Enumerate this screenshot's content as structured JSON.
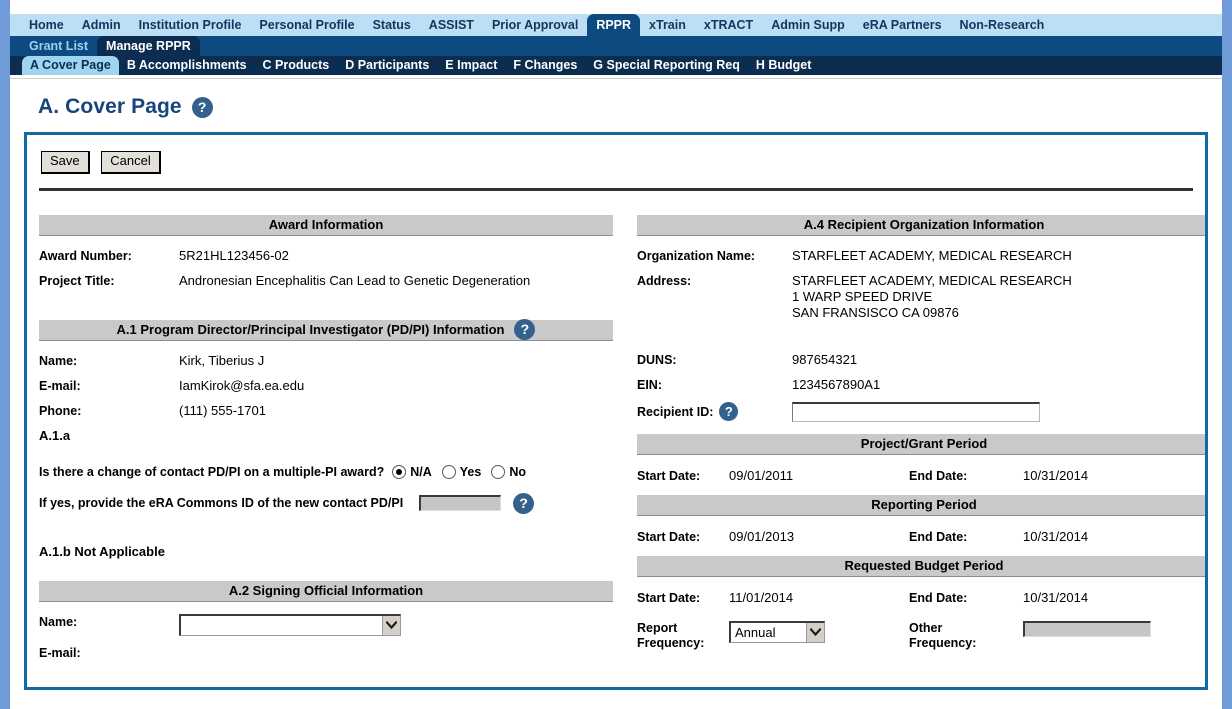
{
  "nav": {
    "main_items": [
      {
        "label": "Home",
        "active": false
      },
      {
        "label": "Admin",
        "active": false
      },
      {
        "label": "Institution Profile",
        "active": false
      },
      {
        "label": "Personal Profile",
        "active": false
      },
      {
        "label": "Status",
        "active": false
      },
      {
        "label": "ASSIST",
        "active": false
      },
      {
        "label": "Prior Approval",
        "active": false
      },
      {
        "label": "RPPR",
        "active": true
      },
      {
        "label": "xTrain",
        "active": false
      },
      {
        "label": "xTRACT",
        "active": false
      },
      {
        "label": "Admin Supp",
        "active": false
      },
      {
        "label": "eRA Partners",
        "active": false
      },
      {
        "label": "Non-Research",
        "active": false
      }
    ],
    "sub_items": [
      {
        "label": "Grant List",
        "active": false
      },
      {
        "label": "Manage RPPR",
        "active": true
      }
    ],
    "tabs": [
      {
        "label": "A Cover Page",
        "active": true
      },
      {
        "label": "B Accomplishments",
        "active": false
      },
      {
        "label": "C Products",
        "active": false
      },
      {
        "label": "D Participants",
        "active": false
      },
      {
        "label": "E Impact",
        "active": false
      },
      {
        "label": "F Changes",
        "active": false
      },
      {
        "label": "G Special Reporting Req",
        "active": false
      },
      {
        "label": "H Budget",
        "active": false
      }
    ]
  },
  "page": {
    "title": "A. Cover Page",
    "help_glyph": "?"
  },
  "toolbar": {
    "save_label": "Save",
    "cancel_label": "Cancel"
  },
  "award_information": {
    "heading": "Award Information",
    "award_number_label": "Award Number:",
    "award_number_value": "5R21HL123456-02",
    "project_title_label": "Project Title:",
    "project_title_value": "Andronesian Encephalitis Can Lead to Genetic Degeneration"
  },
  "pdpi": {
    "heading": "A.1 Program Director/Principal Investigator (PD/PI) Information",
    "name_label": "Name:",
    "name_value": "Kirk, Tiberius J",
    "email_label": "E-mail:",
    "email_value": "IamKirok@sfa.ea.edu",
    "phone_label": "Phone:",
    "phone_value": "(111) 555-1701",
    "subsection_a1a": "A.1.a",
    "change_question": "Is there a change of contact PD/PI on a multiple-PI award?",
    "radio_options": [
      {
        "label": "N/A",
        "checked": true
      },
      {
        "label": "Yes",
        "checked": false
      },
      {
        "label": "No",
        "checked": false
      }
    ],
    "commons_id_label": "If yes, provide the eRA Commons ID of the new contact PD/PI",
    "commons_id_value": "",
    "subsection_a1b": "A.1.b Not Applicable"
  },
  "signing_official": {
    "heading": "A.2 Signing Official Information",
    "name_label": "Name:",
    "name_value": "",
    "email_label": "E-mail:"
  },
  "recipient_org": {
    "heading": "A.4 Recipient Organization Information",
    "org_name_label": "Organization Name:",
    "org_name_value": "STARFLEET ACADEMY, MEDICAL RESEARCH",
    "address_label": "Address:",
    "address_value": "STARFLEET ACADEMY, MEDICAL RESEARCH\n1 WARP SPEED DRIVE\nSAN FRANSISCO CA  09876",
    "duns_label": "DUNS:",
    "duns_value": "987654321",
    "ein_label": "EIN:",
    "ein_value": "1234567890A1",
    "recipient_id_label": "Recipient ID:",
    "recipient_id_value": ""
  },
  "project_period": {
    "heading": "Project/Grant Period",
    "start_label": "Start Date:",
    "start_value": "09/01/2011",
    "end_label": "End Date:",
    "end_value": "10/31/2014"
  },
  "reporting_period": {
    "heading": "Reporting Period",
    "start_label": "Start Date:",
    "start_value": "09/01/2013",
    "end_label": "End Date:",
    "end_value": "10/31/2014"
  },
  "budget_period": {
    "heading": "Requested Budget Period",
    "start_label": "Start Date:",
    "start_value": "11/01/2014",
    "end_label": "End Date:",
    "end_value": "10/31/2014",
    "report_frequency_label": "Report\nFrequency:",
    "report_frequency_value": "Annual",
    "other_frequency_label": "Other\nFrequency:",
    "other_frequency_value": ""
  },
  "colors": {
    "nav_main_bg": "#bcdff5",
    "nav_sub_bg": "#0d4a80",
    "nav_tabs_bg": "#0c2d50",
    "active_tab_bg": "#9fd5f0",
    "title_blue": "#17457c",
    "frame_blue": "#6f9bd8",
    "box_border": "#1268a0",
    "section_gray": "#c9c9c9",
    "help_icon_blue": "#34618c"
  }
}
